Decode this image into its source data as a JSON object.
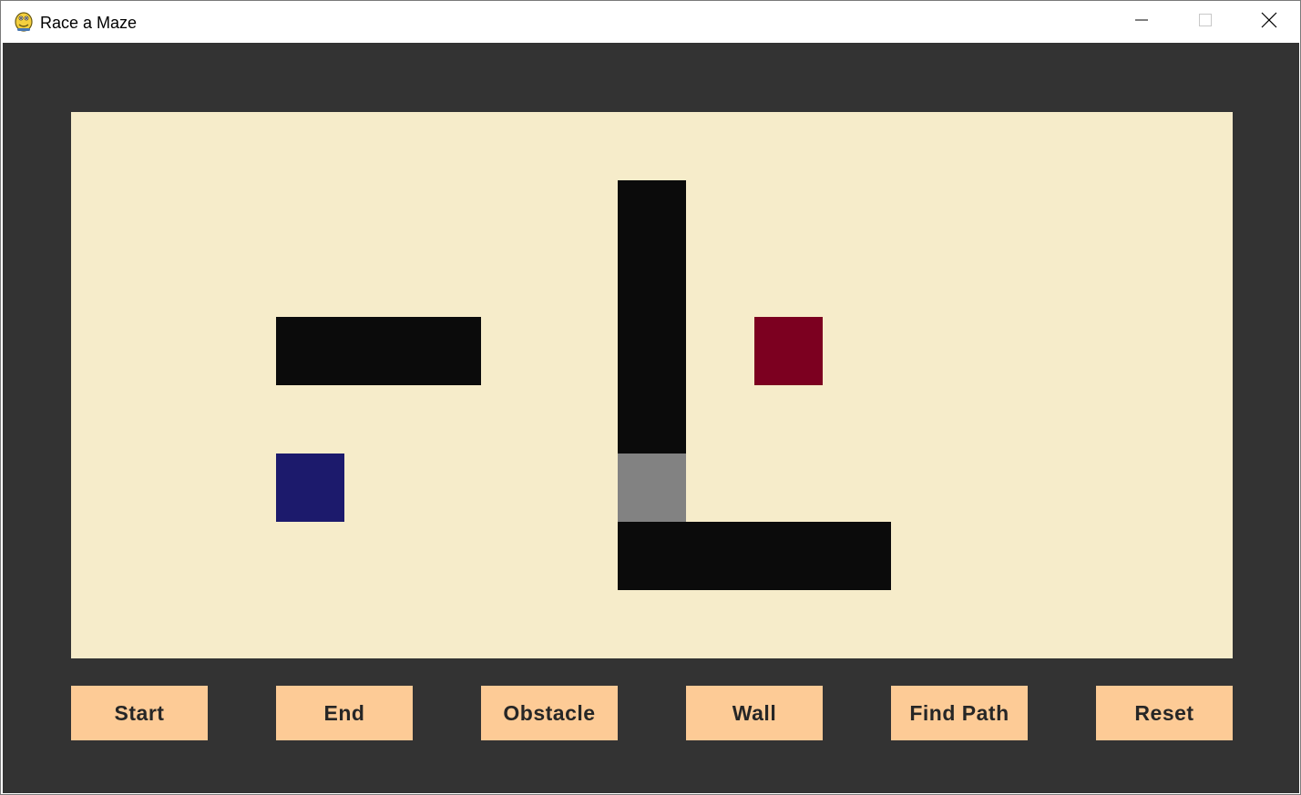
{
  "window": {
    "title": "Race a Maze",
    "icon": "pygame-snake-icon",
    "controls": {
      "minimize_icon": "minimize-icon",
      "maximize_icon": "maximize-icon",
      "close_icon": "close-icon"
    }
  },
  "colors": {
    "background": "#333333",
    "board": "#f6ecca",
    "wall": "#0b0b0b",
    "start": "#1c1a6c",
    "end": "#7c0020",
    "obstacle": "#828282",
    "button": "#fdcb96",
    "button_text": "#262626"
  },
  "buttons": [
    {
      "id": "start",
      "label": "Start"
    },
    {
      "id": "end",
      "label": "End"
    },
    {
      "id": "obstacle",
      "label": "Obstacle"
    },
    {
      "id": "wall",
      "label": "Wall"
    },
    {
      "id": "find_path",
      "label": "Find Path"
    },
    {
      "id": "reset",
      "label": "Reset"
    }
  ],
  "grid": {
    "columns": 17,
    "rows": 8,
    "cells": [
      {
        "type": "wall",
        "col": 3,
        "row": 3
      },
      {
        "type": "wall",
        "col": 4,
        "row": 3
      },
      {
        "type": "wall",
        "col": 5,
        "row": 3
      },
      {
        "type": "wall",
        "col": 8,
        "row": 1
      },
      {
        "type": "wall",
        "col": 8,
        "row": 2
      },
      {
        "type": "wall",
        "col": 8,
        "row": 3
      },
      {
        "type": "wall",
        "col": 8,
        "row": 4
      },
      {
        "type": "obstacle",
        "col": 8,
        "row": 5
      },
      {
        "type": "wall",
        "col": 8,
        "row": 6
      },
      {
        "type": "wall",
        "col": 9,
        "row": 6
      },
      {
        "type": "wall",
        "col": 10,
        "row": 6
      },
      {
        "type": "wall",
        "col": 11,
        "row": 6
      },
      {
        "type": "start",
        "col": 3,
        "row": 5
      },
      {
        "type": "end",
        "col": 10,
        "row": 3
      }
    ]
  }
}
